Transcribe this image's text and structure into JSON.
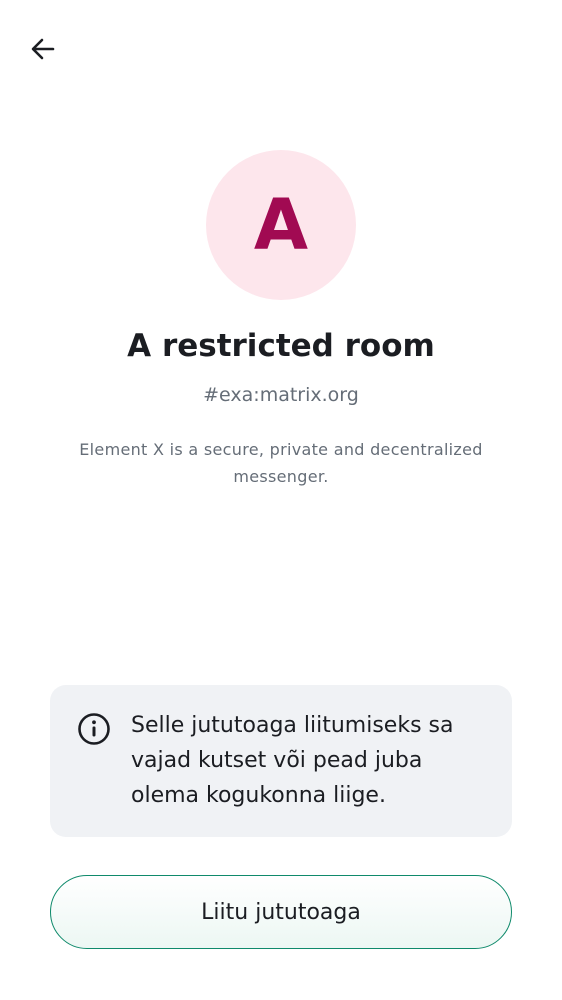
{
  "header": {
    "back_icon": "arrow-left-icon"
  },
  "room": {
    "avatar_letter": "A",
    "name": "A restricted room",
    "alias": "#exa:matrix.org",
    "description": "Element X is a secure, private and decentralized messenger."
  },
  "notice": {
    "icon": "info-icon",
    "text": "Selle jututoaga liitumiseks sa vajad kutset või pead juba olema kogukonna liige."
  },
  "actions": {
    "join_label": "Liitu jututoaga"
  },
  "colors": {
    "avatar_background": "#fde6ec",
    "avatar_letter": "#a10a52",
    "notice_background": "#f0f2f5",
    "button_border": "#0f8a6b",
    "primary_text": "#1b1d22",
    "secondary_text": "#656d77"
  }
}
